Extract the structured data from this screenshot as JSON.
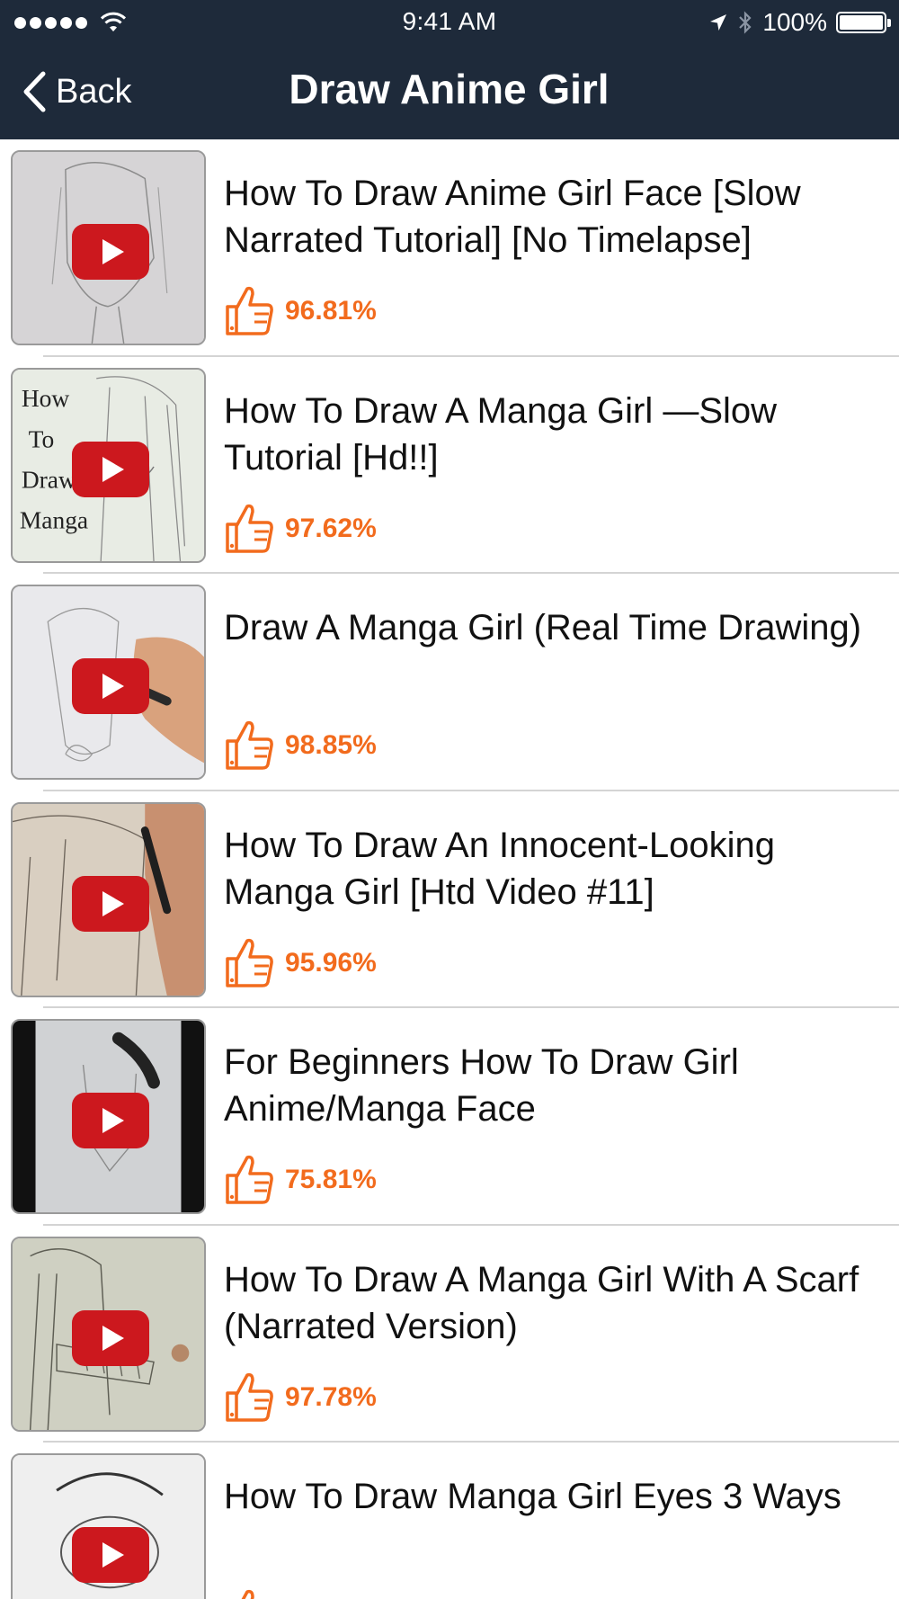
{
  "status_bar": {
    "time": "9:41 AM",
    "battery_text": "100%"
  },
  "nav": {
    "back_label": "Back",
    "title": "Draw Anime Girl"
  },
  "colors": {
    "nav_background": "#1e2a3a",
    "rating_orange": "#f26b1d",
    "play_red": "#cc181e"
  },
  "videos": [
    {
      "title": "How To Draw Anime Girl Face [Slow Narrated Tutorial] [No Timelapse]",
      "rating": "96.81%"
    },
    {
      "title": "How To Draw A Manga Girl —Slow Tutorial [Hd!!]",
      "rating": "97.62%",
      "thumb_caption": [
        "How",
        "To",
        "Draw",
        "Manga"
      ]
    },
    {
      "title": "Draw A Manga Girl (Real Time Drawing)",
      "rating": "98.85%"
    },
    {
      "title": "How To Draw An Innocent-Looking Manga Girl [Htd Video #11]",
      "rating": "95.96%"
    },
    {
      "title": "For Beginners How To Draw Girl Anime/Manga Face",
      "rating": "75.81%"
    },
    {
      "title": "How To Draw A Manga Girl With A Scarf (Narrated Version)",
      "rating": "97.78%"
    },
    {
      "title": "How To Draw Manga Girl Eyes 3 Ways",
      "rating": ""
    }
  ]
}
